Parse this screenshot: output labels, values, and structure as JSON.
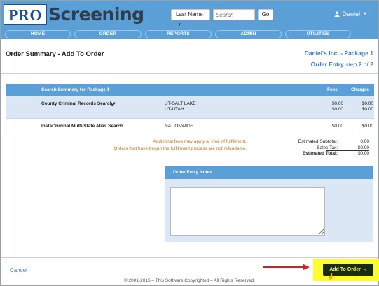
{
  "header": {
    "logo_pro": "PRO",
    "logo_screening": "Screening",
    "search_type": "Last Name",
    "search_placeholder": "Search",
    "go_label": "Go",
    "user_name": "Daniel"
  },
  "nav": [
    "HOME",
    "ORDER",
    "REPORTS",
    "ADMIN",
    "UTILITIES"
  ],
  "page": {
    "title": "Order Summary - Add To Order",
    "company": "Daniel's Inc. - Package 1",
    "step_prefix": "Order Entry",
    "step_word": "step",
    "step_num": "2",
    "step_of": "of",
    "step_total": "2"
  },
  "summary": {
    "header": "Search Summary for Package 1",
    "col_fees": "Fees",
    "col_charges": "Charges",
    "rows": [
      {
        "name": "County Criminal Records Search",
        "locations": [
          "UT-SALT LAKE",
          "UT-UTAH"
        ],
        "fees": [
          "$0.00",
          "$0.00"
        ],
        "charges": [
          "$0.00",
          "$0.00"
        ]
      },
      {
        "name": "InstaCriminal Multi-State Alias Search",
        "locations": [
          "NATIONWIDE"
        ],
        "fees": [
          "$0.00"
        ],
        "charges": [
          "$0.00"
        ]
      }
    ]
  },
  "notes": {
    "line1": "Additional fees may apply at time of fulfillment.",
    "line2": "Orders that have begun the fulfillment process are not refundable."
  },
  "totals": {
    "subtotal_label": "Estimated Subtotal:",
    "subtotal_value": "0.00",
    "tax_label": "Sales Tax:",
    "tax_value": "$0.00",
    "total_label": "Estimated Total:",
    "total_value": "$0.00"
  },
  "order_notes": {
    "header": "Order Entry Notes"
  },
  "actions": {
    "cancel": "Cancel",
    "add": "Add To Order",
    "add_icon": "→"
  },
  "footer": "© 2001-2015 – This Software Copyrighted – All Rights Reserved.",
  "colors": {
    "header_bg": "#5aa0d6",
    "link": "#3a7bc8",
    "note": "#c07820",
    "highlight": "#fcfc2e",
    "add_button_bg": "#1a2c12",
    "add_button_text": "#f5ef50",
    "arrow": "#d42020"
  }
}
